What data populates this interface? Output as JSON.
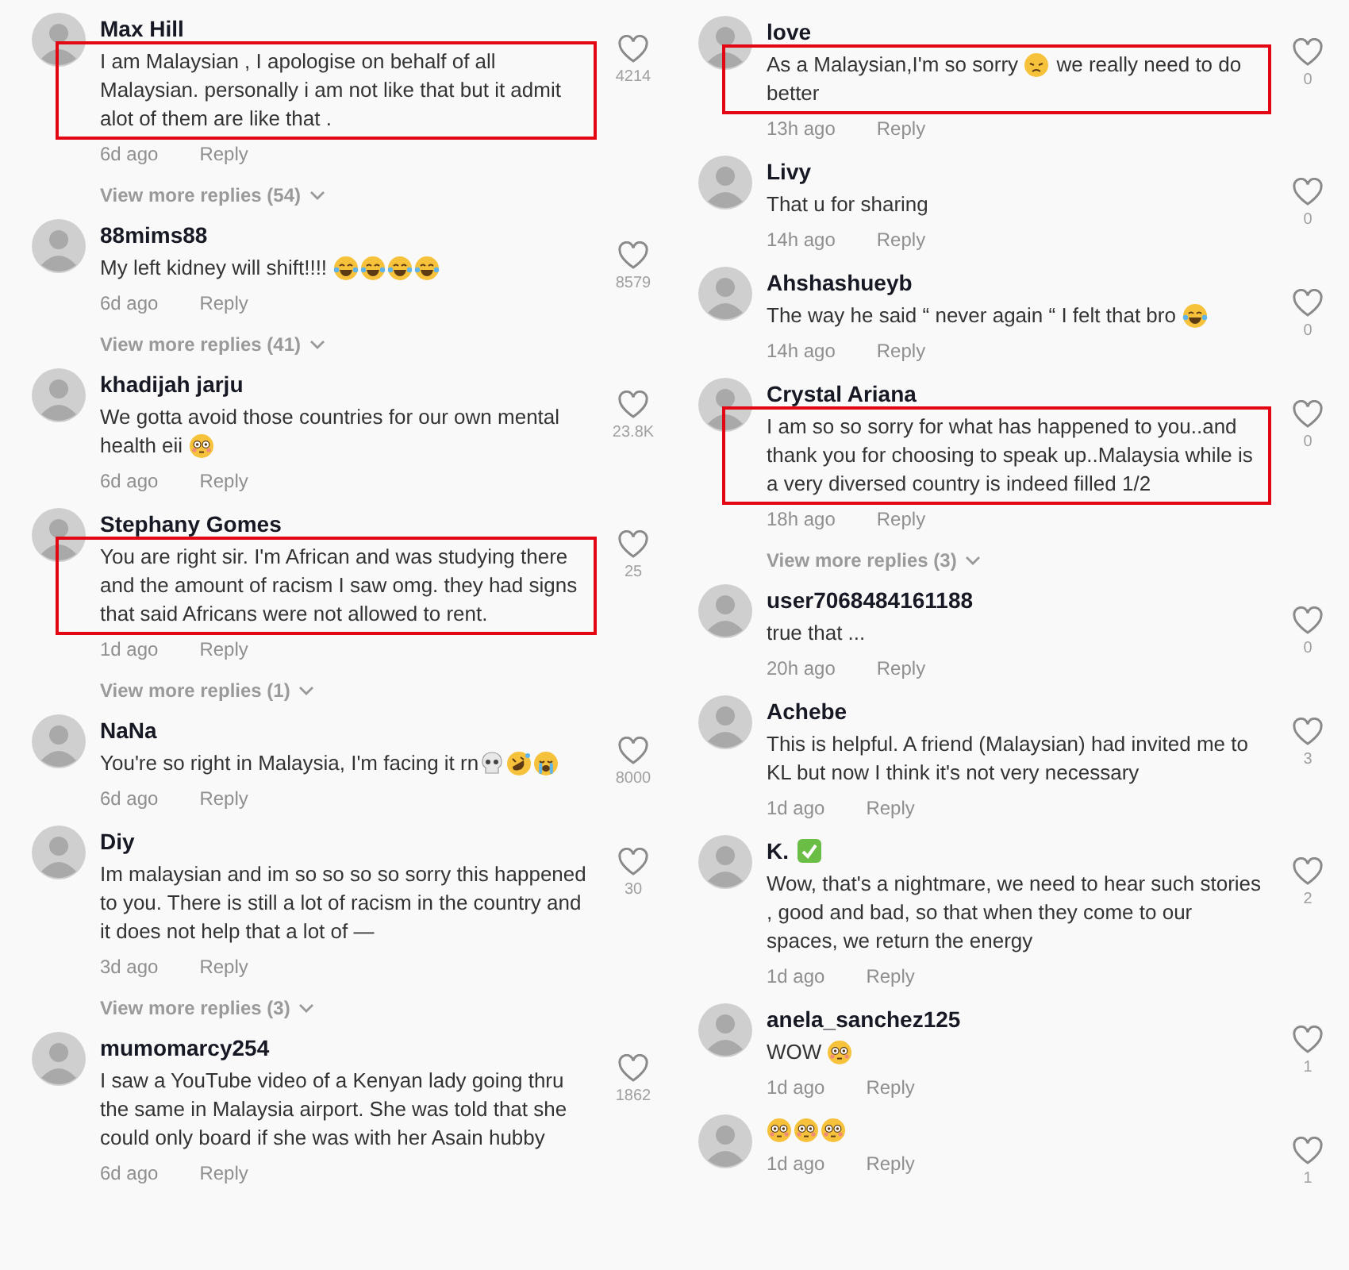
{
  "columns": [
    {
      "comments": [
        {
          "name": "Max Hill",
          "highlighted": true,
          "body": [
            {
              "kind": "text",
              "text": "I am Malaysian , I apologise on behalf of all Malaysian. personally i am not like that but it admit alot of them are like that ."
            }
          ],
          "time": "6d ago",
          "reply": "Reply",
          "likes": "4214",
          "more": "View more replies (54)"
        },
        {
          "name": "88mims88",
          "highlighted": false,
          "body": [
            {
              "kind": "text",
              "text": "My left kidney will shift!!!! "
            },
            {
              "kind": "laughing"
            },
            {
              "kind": "laughing"
            },
            {
              "kind": "laughing"
            },
            {
              "kind": "laughing"
            }
          ],
          "time": "6d ago",
          "reply": "Reply",
          "likes": "8579",
          "more": "View more replies (41)"
        },
        {
          "name": "khadijah jarju",
          "highlighted": false,
          "body": [
            {
              "kind": "text",
              "text": "We gotta avoid those countries for our own mental"
            },
            {
              "kind": "text",
              "text": "health eii "
            },
            {
              "kind": "flushed"
            }
          ],
          "time": "6d ago",
          "reply": "Reply",
          "likes": "23.8K"
        },
        {
          "name": "Stephany Gomes",
          "highlighted": true,
          "body": [
            {
              "kind": "text",
              "text": "You are right sir. I'm African and was studying there and the amount of racism I saw omg. they had signs that said Africans were not allowed to rent."
            }
          ],
          "time": "1d ago",
          "reply": "Reply",
          "likes": "25",
          "more": "View more replies (1)"
        },
        {
          "name": "NaNa",
          "highlighted": false,
          "body": [
            {
              "kind": "text",
              "text": "You're so right in Malaysia, I'm facing it rn"
            },
            {
              "kind": "skull"
            },
            {
              "kind": "rofl"
            },
            {
              "kind": "crying"
            }
          ],
          "time": "6d ago",
          "reply": "Reply",
          "likes": "8000"
        },
        {
          "name": "Diy",
          "highlighted": false,
          "body": [
            {
              "kind": "text",
              "text": "Im malaysian and im so so so so sorry this happened to you. There is still a lot of racism in the country and it does not help that a lot of —"
            }
          ],
          "time": "3d ago",
          "reply": "Reply",
          "likes": "30",
          "more": "View more replies (3)"
        },
        {
          "name": "mumomarcy254",
          "highlighted": false,
          "body": [
            {
              "kind": "text",
              "text": "I saw a YouTube video of a Kenyan lady going thru the same in Malaysia airport. She was told that she could only board if she was with her Asain hubby"
            }
          ],
          "time": "6d ago",
          "reply": "Reply",
          "likes": "1862"
        }
      ]
    },
    {
      "comments": [
        {
          "name": "love",
          "highlighted": true,
          "body": [
            {
              "kind": "text",
              "text": "As a Malaysian,I'm so sorry "
            },
            {
              "kind": "sad"
            },
            {
              "kind": "text",
              "text": " we really need to do"
            },
            {
              "kind": "text",
              "text": "better"
            }
          ],
          "time": "13h ago",
          "reply": "Reply",
          "likes": "0"
        },
        {
          "name": "Livy",
          "highlighted": false,
          "body": [
            {
              "kind": "text",
              "text": "That u for sharing"
            }
          ],
          "time": "14h ago",
          "reply": "Reply",
          "likes": "0"
        },
        {
          "name": "Ahshashueyb",
          "highlighted": false,
          "body": [
            {
              "kind": "text",
              "text": "The way he said “ never again “ I felt that bro "
            },
            {
              "kind": "laughing"
            }
          ],
          "time": "14h ago",
          "reply": "Reply",
          "likes": "0"
        },
        {
          "name": "Crystal Ariana",
          "highlighted": true,
          "body": [
            {
              "kind": "text",
              "text": "I am so so sorry for what has happened to you..and thank you for choosing to speak up..Malaysia while is a very diversed country is indeed filled 1/2"
            }
          ],
          "time": "18h ago",
          "reply": "Reply",
          "likes": "0",
          "more": "View more replies (3)"
        },
        {
          "name": "user7068484161188",
          "highlighted": false,
          "body": [
            {
              "kind": "text",
              "text": "true that ..."
            }
          ],
          "time": "20h ago",
          "reply": "Reply",
          "likes": "0"
        },
        {
          "name": "Achebe",
          "highlighted": false,
          "body": [
            {
              "kind": "text",
              "text": "This is helpful. A friend (Malaysian) had invited me to KL but now I think it's not very necessary"
            }
          ],
          "time": "1d ago",
          "reply": "Reply",
          "likes": "3"
        },
        {
          "name": "K.",
          "badge": {
            "kind": "check"
          },
          "highlighted": false,
          "body": [
            {
              "kind": "text",
              "text": "Wow, that's a nightmare, we need to hear such stories , good and bad, so that when they come to our spaces, we return the energy"
            }
          ],
          "time": "1d ago",
          "reply": "Reply",
          "likes": "2"
        },
        {
          "name": "anela_sanchez125",
          "highlighted": false,
          "body": [
            {
              "kind": "text",
              "text": "WOW "
            },
            {
              "kind": "flushed"
            }
          ],
          "time": "1d ago",
          "reply": "Reply",
          "likes": "1"
        },
        {
          "highlighted": false,
          "body": [
            {
              "kind": "flushed"
            },
            {
              "kind": "flushed"
            },
            {
              "kind": "flushed"
            }
          ],
          "time": "1d ago",
          "reply": "Reply",
          "likes": "1"
        }
      ]
    }
  ]
}
